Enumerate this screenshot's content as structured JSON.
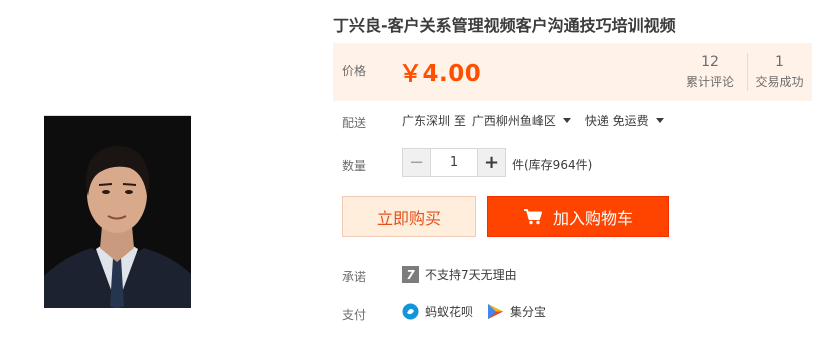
{
  "product": {
    "title": "丁兴良-客户关系管理视频客户沟通技巧培训视频",
    "photo_icon": "person-portrait"
  },
  "price": {
    "label": "价格",
    "value": "￥4.00",
    "accent_color": "#ff5000"
  },
  "stats": {
    "reviews_count": "12",
    "reviews_label": "累计评论",
    "trades_count": "1",
    "trades_label": "交易成功"
  },
  "delivery": {
    "label": "配送",
    "from": "广东深圳 至",
    "to": "广西柳州鱼峰区",
    "shipping": "快递 免运费"
  },
  "quantity": {
    "label": "数量",
    "minus": "−",
    "value": "1",
    "plus": "+",
    "stock": "件(库存964件)"
  },
  "actions": {
    "buy_now": "立即购买",
    "add_to_cart": "加入购物车",
    "cart_icon": "cart-icon"
  },
  "promise": {
    "label": "承诺",
    "icon_text": "7",
    "text": "不支持7天无理由"
  },
  "payment": {
    "label": "支付",
    "methods": [
      {
        "name": "蚂蚁花呗",
        "icon": "huabei-icon",
        "color": "#1296db"
      },
      {
        "name": "集分宝",
        "icon": "jifenbao-icon",
        "color": "#34a853"
      }
    ]
  }
}
